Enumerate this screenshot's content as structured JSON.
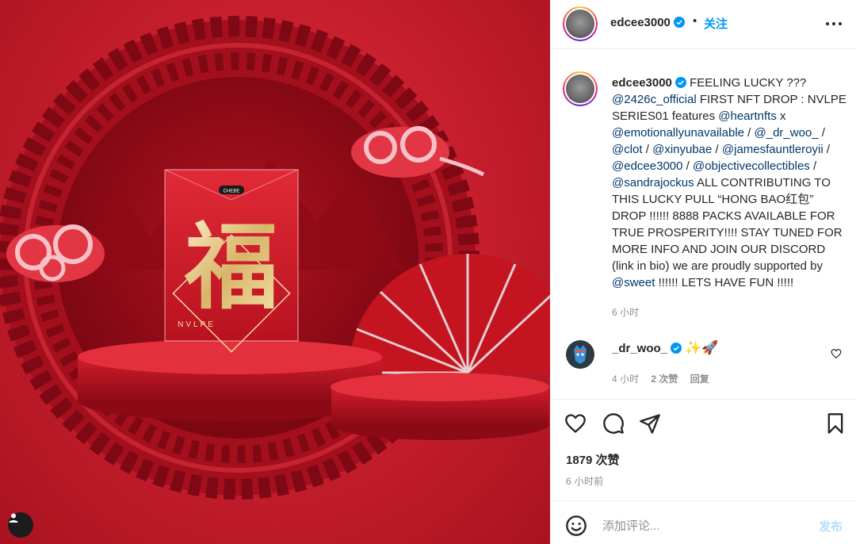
{
  "post": {
    "author": "edcee3000",
    "follow_label": "关注",
    "separator": "•",
    "card": {
      "brand_badge": "CHEBE",
      "character": "福",
      "brand": "NVLPE"
    }
  },
  "caption": {
    "username": "edcee3000",
    "segments": [
      {
        "t": "FEELING LUCKY ??? "
      },
      {
        "t": "@2426c_official",
        "mention": true
      },
      {
        "t": " FIRST NFT DROP : NVLPE SERIES01 features "
      },
      {
        "t": "@heartnfts",
        "mention": true
      },
      {
        "t": " x "
      },
      {
        "t": "@emotionallyunavailable",
        "mention": true
      },
      {
        "t": " / "
      },
      {
        "t": "@_dr_woo_",
        "mention": true
      },
      {
        "t": " / "
      },
      {
        "t": "@clot",
        "mention": true
      },
      {
        "t": " / "
      },
      {
        "t": "@xinyubae",
        "mention": true
      },
      {
        "t": " / "
      },
      {
        "t": "@jamesfauntleroyii",
        "mention": true
      },
      {
        "t": " / "
      },
      {
        "t": "@edcee3000",
        "mention": true
      },
      {
        "t": " / "
      },
      {
        "t": "@objectivecollectibles",
        "mention": true
      },
      {
        "t": " / "
      },
      {
        "t": "@sandrajockus",
        "mention": true
      },
      {
        "t": " ALL CONTRIBUTING TO THIS LUCKY PULL “HONG BAO红包” DROP !!!!!! 8888 PACKS AVAILABLE FOR TRUE PROSPERITY!!!! STAY TUNED FOR MORE INFO AND JOIN OUR DISCORD (link in bio) we are proudly supported by "
      },
      {
        "t": "@sweet",
        "mention": true
      },
      {
        "t": " !!!!!! LETS HAVE FUN !!!!!"
      }
    ],
    "time": "6 小时"
  },
  "comment": {
    "username": "_dr_woo_",
    "text": "✨🚀",
    "time": "4 小时",
    "likes": "2 次赞",
    "reply": "回复"
  },
  "stats": {
    "likes": "1879 次赞",
    "time": "6 小时前"
  },
  "composer": {
    "placeholder": "添加评论...",
    "publish_label": "发布"
  },
  "colors": {
    "accent": "#0095f6",
    "mention": "#00376b",
    "muted": "#8e8e8e",
    "publish_disabled": "#b2dffc",
    "background_red": "#c9202f"
  },
  "icons": [
    "user-tag-icon",
    "more-icon",
    "verified-icon",
    "heart-icon",
    "comment-icon",
    "share-icon",
    "bookmark-icon",
    "emoji-icon"
  ]
}
